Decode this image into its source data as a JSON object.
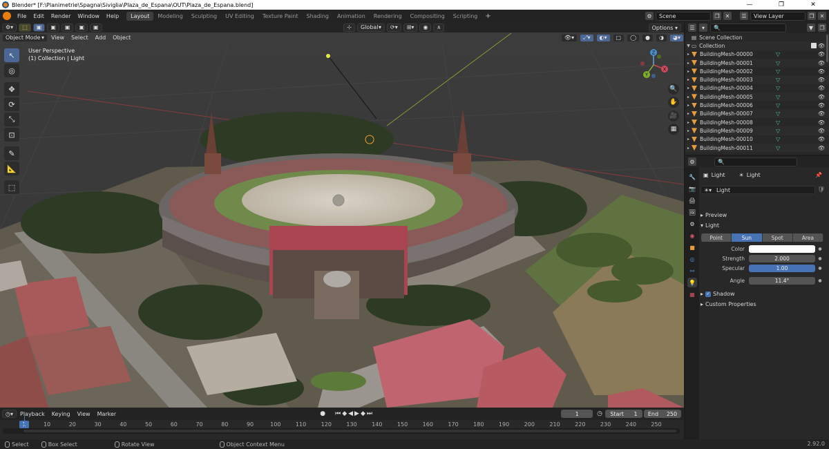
{
  "window": {
    "title": "Blender* [F:\\Planimetrie\\Spagna\\Siviglia\\Plaza_de_Espana\\OUT\\Plaza_de_Espana.blend]",
    "minimize": "—",
    "maximize": "❐",
    "close": "✕"
  },
  "menu": [
    "File",
    "Edit",
    "Render",
    "Window",
    "Help"
  ],
  "workspaces": [
    "Layout",
    "Modeling",
    "Sculpting",
    "UV Editing",
    "Texture Paint",
    "Shading",
    "Animation",
    "Rendering",
    "Compositing",
    "Scripting"
  ],
  "add_workspace": "+",
  "scene": {
    "name": "Scene",
    "view_layer": "View Layer"
  },
  "viewport": {
    "orientation": "Global",
    "mode": "Object Mode",
    "menus": [
      "View",
      "Select",
      "Add",
      "Object"
    ],
    "options": "Options",
    "overlay_line1": "User Perspective",
    "overlay_line2": "(1) Collection | Light",
    "gizmo": {
      "x": "X",
      "y": "Y",
      "z": "Z"
    }
  },
  "timeline": {
    "menus": [
      "Playback",
      "Keying",
      "View",
      "Marker"
    ],
    "current_frame": "1",
    "start_label": "Start",
    "start": "1",
    "end_label": "End",
    "end": "250",
    "ruler": [
      "1",
      "10",
      "20",
      "30",
      "40",
      "50",
      "60",
      "70",
      "80",
      "90",
      "100",
      "110",
      "120",
      "130",
      "140",
      "150",
      "160",
      "170",
      "180",
      "190",
      "200",
      "210",
      "220",
      "230",
      "240",
      "250"
    ]
  },
  "status": {
    "select": "Select",
    "box_select": "Box Select",
    "rotate_view": "Rotate View",
    "context_menu": "Object Context Menu",
    "version": "2.92.0"
  },
  "outliner": {
    "scene_collection": "Scene Collection",
    "collection": "Collection",
    "items": [
      "BuildingMesh-00000",
      "BuildingMesh-00001",
      "BuildingMesh-00002",
      "BuildingMesh-00003",
      "BuildingMesh-00004",
      "BuildingMesh-00005",
      "BuildingMesh-00006",
      "BuildingMesh-00007",
      "BuildingMesh-00008",
      "BuildingMesh-00009",
      "BuildingMesh-00010",
      "BuildingMesh-00011"
    ]
  },
  "properties": {
    "crumb_object": "Light",
    "crumb_data": "Light",
    "datablock": "Light",
    "preview": "Preview",
    "light_panel": "Light",
    "light_types": [
      "Point",
      "Sun",
      "Spot",
      "Area"
    ],
    "active_type": "Sun",
    "color_label": "Color",
    "strength_label": "Strength",
    "strength": "2.000",
    "specular_label": "Specular",
    "specular": "1.00",
    "angle_label": "Angle",
    "angle": "11.4°",
    "shadow": "Shadow",
    "custom_properties": "Custom Properties"
  },
  "colors": {
    "accent": "#4772b3",
    "header": "#232323",
    "panel": "#282828",
    "light_color": "#ffffff"
  }
}
